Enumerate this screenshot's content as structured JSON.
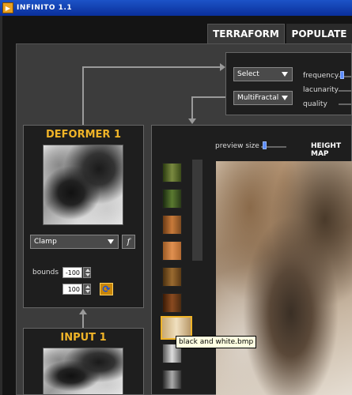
{
  "window": {
    "title": "INFINITO 1.1",
    "icon": "app-logo-icon"
  },
  "tabs": [
    {
      "label": "TERRAFORM",
      "active": true
    },
    {
      "label": "POPULATE",
      "active": false
    }
  ],
  "noise_panel": {
    "select_dropdown": "Select",
    "fractal_dropdown": "MultiFractal",
    "params": {
      "frequency": "frequency",
      "lacunarity": "lacunarity",
      "quality": "quality"
    }
  },
  "deformer": {
    "title": "DEFORMER 1",
    "mode_dropdown": "Clamp",
    "function_button": "f",
    "bounds_label": "bounds",
    "bounds_min": "-100",
    "bounds_max": "100"
  },
  "input": {
    "title": "INPUT 1"
  },
  "preview": {
    "preview_size_label": "preview size",
    "height_map_label": "HEIGHT MAP",
    "tooltip": "black and white.bmp"
  },
  "colors": {
    "accent": "#f0b428",
    "slider": "#5b8cff",
    "tab_active": "#3a3a3a"
  }
}
